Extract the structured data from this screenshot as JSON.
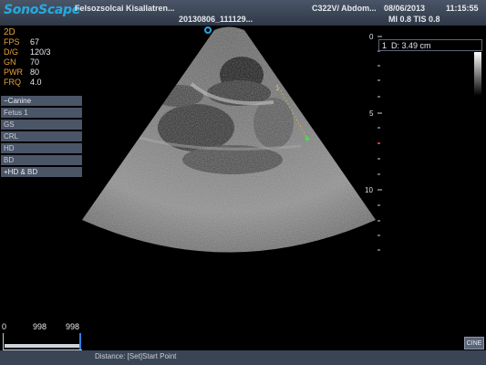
{
  "header": {
    "brand": "SonoScape",
    "patient_name": "Felsozsolcai Kisallatren...",
    "exam_id": "20130806_111129...",
    "probe_preset": "C322V/ Abdom...",
    "date": "08/06/2013",
    "time": "11:15:55",
    "safety_index": "MI 0.8 TIS 0.8"
  },
  "params": {
    "mode": "2D",
    "rows": [
      {
        "key": "FPS",
        "value": "67"
      },
      {
        "key": "D/G",
        "value": "120/3"
      },
      {
        "key": "GN",
        "value": "70"
      },
      {
        "key": "PWR",
        "value": "80"
      },
      {
        "key": "FRQ",
        "value": "4.0"
      }
    ]
  },
  "menu": {
    "items": [
      {
        "label": "Canine",
        "prefix": "−"
      },
      {
        "label": "Fetus 1",
        "prefix": ""
      },
      {
        "label": "GS",
        "prefix": ""
      },
      {
        "label": "CRL",
        "prefix": ""
      },
      {
        "label": "HD",
        "prefix": ""
      },
      {
        "label": "BD",
        "prefix": ""
      },
      {
        "label": "HD & BD",
        "prefix": "+"
      }
    ]
  },
  "depth_scale": {
    "labels": [
      "0",
      "5",
      "10"
    ]
  },
  "measurement": {
    "index": "1",
    "text": "D: 3.49   cm"
  },
  "cine": {
    "start": "0",
    "current": "998",
    "end": "998",
    "progress": 1.0
  },
  "status_text": "Distance: [Set]Start Point",
  "cine_button": "CINE",
  "colors": {
    "brand": "#28a9e0",
    "param_key": "#e6a33c",
    "caliper_1": "#e6c63c",
    "caliper_2": "#3ce64a",
    "focus_marker": "#e03030"
  }
}
